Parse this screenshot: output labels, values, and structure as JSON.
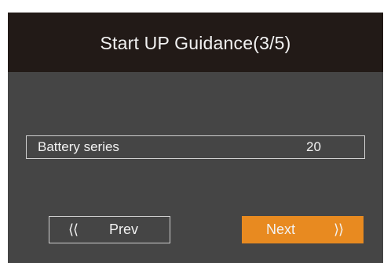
{
  "header": {
    "title": "Start UP Guidance(3/5)"
  },
  "battery_series": {
    "label": "Battery series",
    "value": "20"
  },
  "buttons": {
    "prev_label": "Prev",
    "prev_icon": "⟨⟨",
    "next_label": "Next",
    "next_icon": "⟩⟩"
  },
  "colors": {
    "background": "#454545",
    "header": "#221a17",
    "accent": "#e88a20",
    "text": "#f2f2f2"
  }
}
